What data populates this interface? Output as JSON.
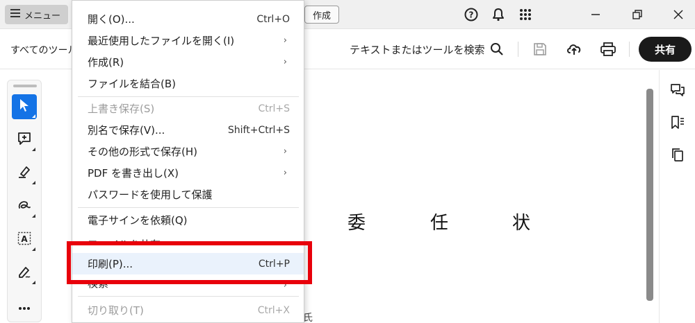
{
  "topbar": {
    "menu_label": "メニュー",
    "create_label": "作成"
  },
  "toolbar": {
    "all_tools": "すべてのツール",
    "search_label": "テキストまたはツールを検索",
    "share_label": "共有"
  },
  "document": {
    "title_chars": [
      "委",
      "任",
      "状"
    ],
    "partial_text": "氏"
  },
  "menu": {
    "items": [
      {
        "label": "開く(O)...",
        "shortcut": "Ctrl+O",
        "submenu": false,
        "disabled": false
      },
      {
        "label": "最近使用したファイルを開く(I)",
        "shortcut": "",
        "submenu": true,
        "disabled": false
      },
      {
        "label": "作成(R)",
        "shortcut": "",
        "submenu": true,
        "disabled": false
      },
      {
        "label": "ファイルを結合(B)",
        "shortcut": "",
        "submenu": false,
        "disabled": false
      },
      {
        "label": "上書き保存(S)",
        "shortcut": "Ctrl+S",
        "submenu": false,
        "disabled": true
      },
      {
        "label": "別名で保存(V)...",
        "shortcut": "Shift+Ctrl+S",
        "submenu": false,
        "disabled": false
      },
      {
        "label": "その他の形式で保存(H)",
        "shortcut": "",
        "submenu": true,
        "disabled": false
      },
      {
        "label": "PDF を書き出し(X)",
        "shortcut": "",
        "submenu": true,
        "disabled": false
      },
      {
        "label": "パスワードを使用して保護",
        "shortcut": "",
        "submenu": false,
        "disabled": false
      },
      {
        "label": "電子サインを依頼(Q)",
        "shortcut": "",
        "submenu": false,
        "disabled": false
      },
      {
        "label": "ファイルを共有",
        "shortcut": "",
        "submenu": false,
        "disabled": false
      },
      {
        "label": "印刷(P)...",
        "shortcut": "Ctrl+P",
        "submenu": false,
        "disabled": false,
        "highlighted": true
      },
      {
        "label": "検索",
        "shortcut": "",
        "submenu": true,
        "disabled": false
      },
      {
        "label": "切り取り(T)",
        "shortcut": "Ctrl+X",
        "submenu": false,
        "disabled": true
      }
    ],
    "submenu_arrow": "›"
  },
  "icons": {
    "help": "help-icon",
    "bell": "bell-icon",
    "apps": "apps-grid-icon"
  },
  "colors": {
    "accent": "#1473e6",
    "highlight_box": "#e8000b",
    "share_bg": "#1a1a1a"
  }
}
